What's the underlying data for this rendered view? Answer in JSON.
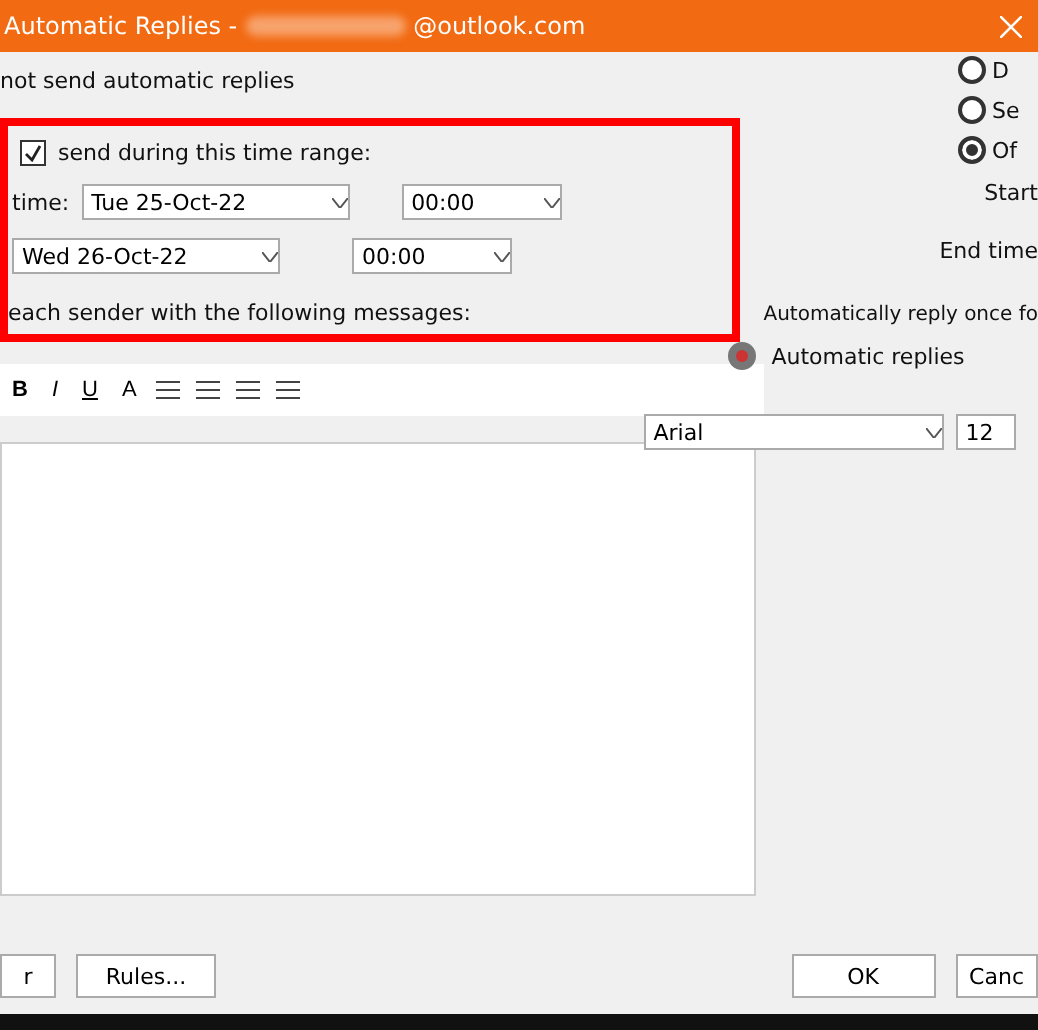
{
  "window": {
    "title": "Automatic Replies -",
    "title_suffix": "@outlook.com"
  },
  "left": {
    "no_send": "not send automatic replies",
    "range_label": "send during this time range:",
    "range_checked": true,
    "start_label": "time:",
    "start_date": "Tue 25-Oct-22",
    "start_time": "00:00",
    "end_date": "Wed 26-Oct-22",
    "end_time": "00:00",
    "message_label": "each sender with the following messages:"
  },
  "right": {
    "options": [
      {
        "label": "D",
        "selected": false
      },
      {
        "label": "Se",
        "selected": false
      },
      {
        "label": "Of",
        "selected": true
      }
    ],
    "start_label": "Start",
    "end_label": "End time",
    "reply_once": "Automatically reply once fo",
    "tab_label": "Automatic replies"
  },
  "toolbar": {
    "buttons": [
      "B",
      "I",
      "U",
      "A"
    ],
    "font": "Arial",
    "size": "12"
  },
  "buttons": {
    "left_cut": "r",
    "rules": "Rules...",
    "ok": "OK",
    "cancel": "Canc"
  }
}
